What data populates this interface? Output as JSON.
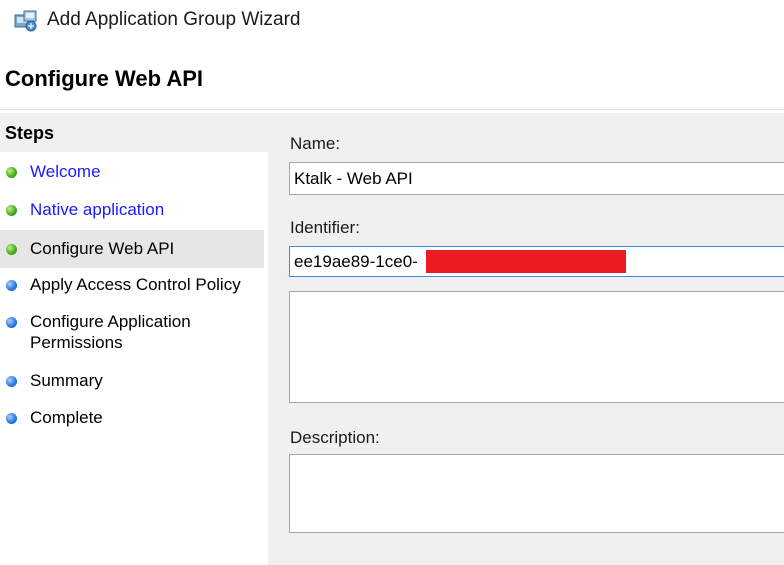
{
  "window": {
    "title": "Add Application Group Wizard",
    "icon": "application-group-icon"
  },
  "page": {
    "title": "Configure Web API"
  },
  "steps": {
    "header": "Steps",
    "items": [
      {
        "label": "Welcome",
        "status": "complete",
        "link": true
      },
      {
        "label": "Native application",
        "status": "complete",
        "link": true
      },
      {
        "label": "Configure Web API",
        "status": "current",
        "link": false
      },
      {
        "label": "Apply Access Control Policy",
        "status": "pending",
        "link": false
      },
      {
        "label": "Configure Application Permissions",
        "status": "pending",
        "link": false
      },
      {
        "label": "Summary",
        "status": "pending",
        "link": false
      },
      {
        "label": "Complete",
        "status": "pending",
        "link": false
      }
    ]
  },
  "form": {
    "name_label": "Name:",
    "name_value": "Ktalk - Web API",
    "identifier_label": "Identifier:",
    "identifier_value": "ee19ae89-1ce0-",
    "description_label": "Description:",
    "description_value": ""
  },
  "colors": {
    "complete": "#4caf1e",
    "pending": "#2b7be0",
    "link": "#1a1aff",
    "redaction": "#ec1c24"
  }
}
